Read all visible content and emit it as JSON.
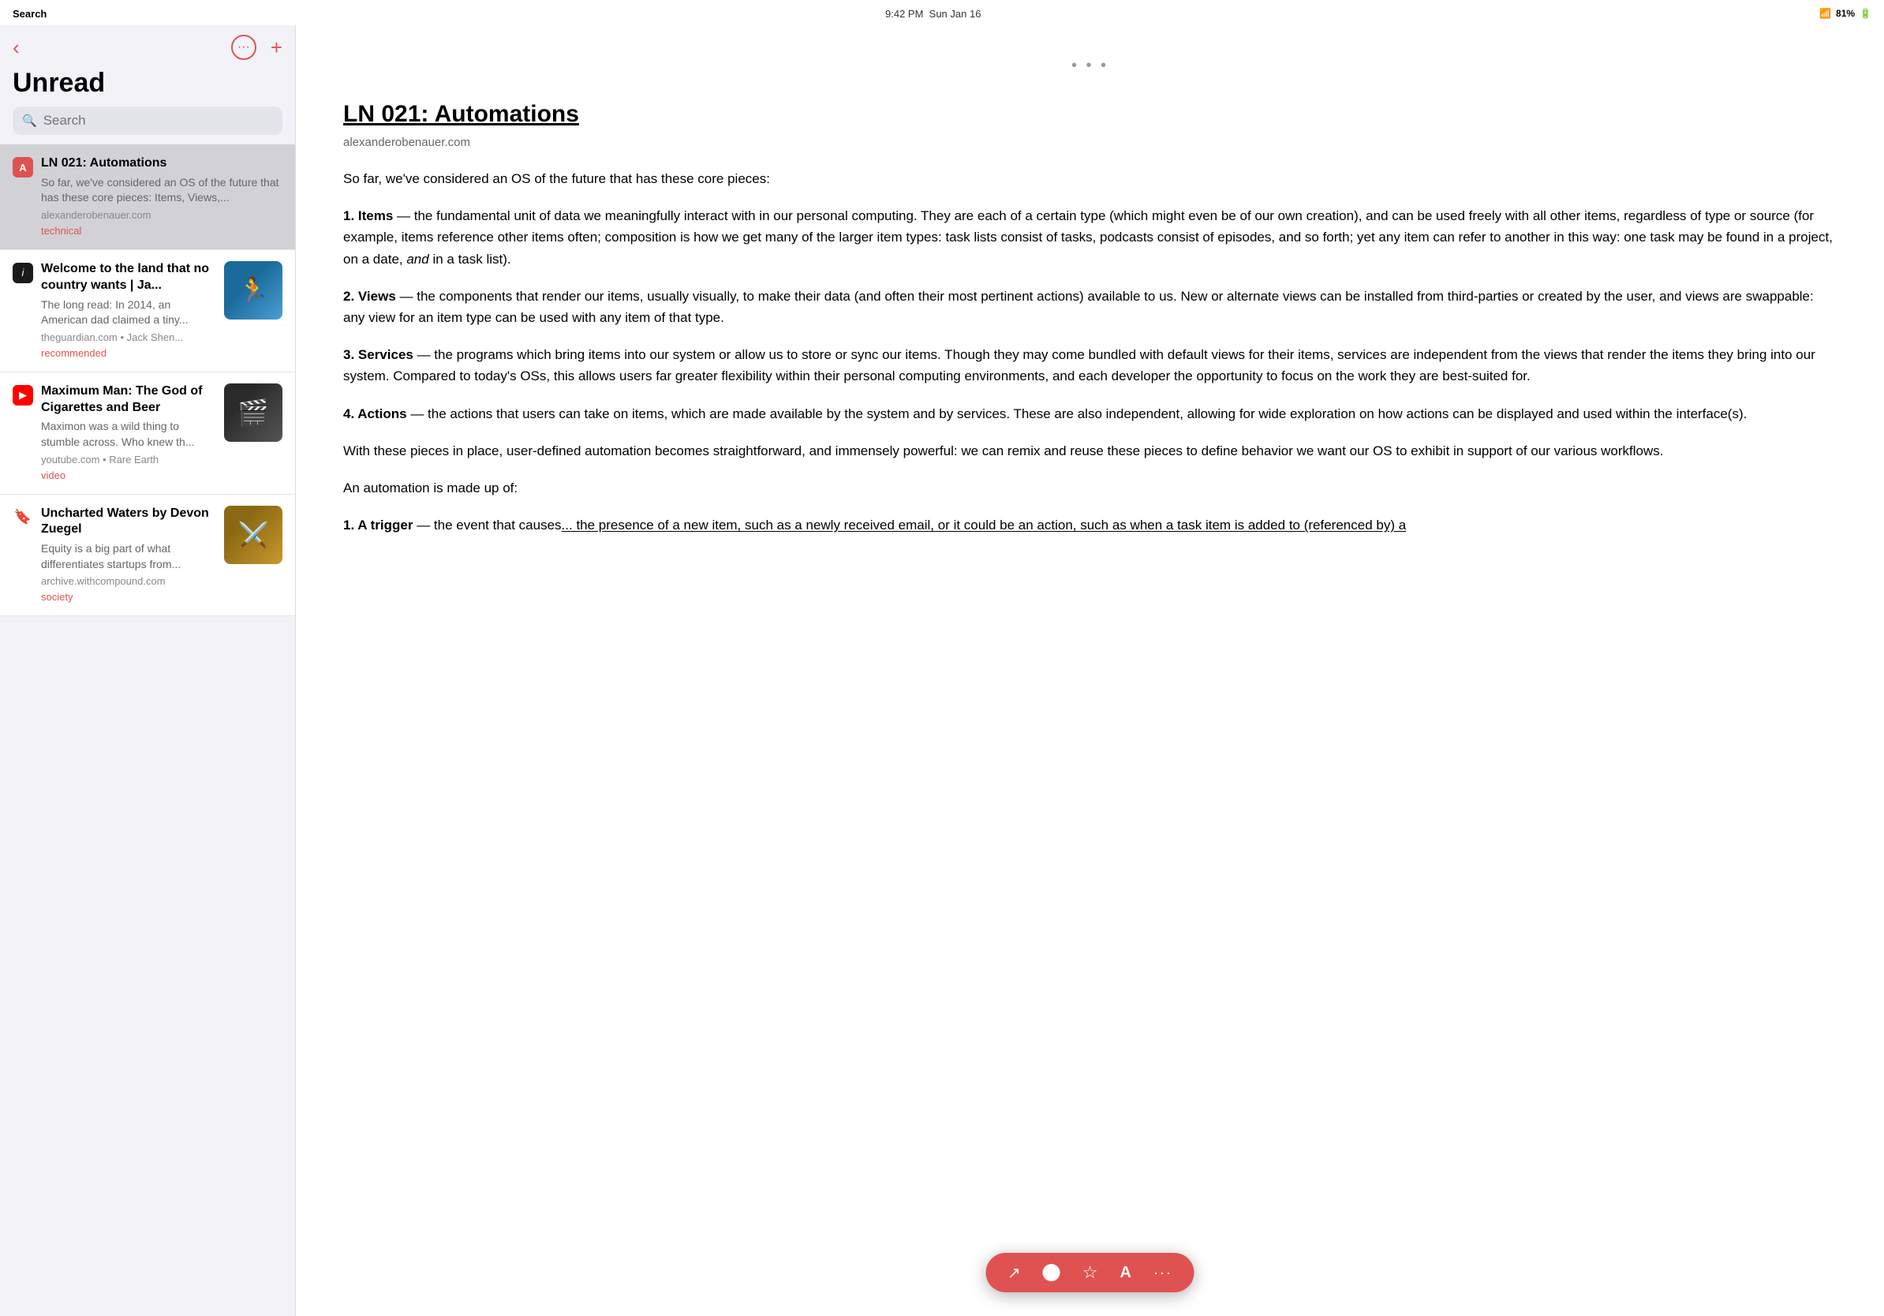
{
  "statusBar": {
    "carrier": "Search",
    "time": "9:42 PM",
    "date": "Sun Jan 16",
    "wifi": "WiFi",
    "battery": "81%"
  },
  "sidebar": {
    "title": "Unread",
    "search_placeholder": "Search",
    "back_label": "‹",
    "more_label": "···",
    "add_label": "+",
    "articles": [
      {
        "id": "ln021",
        "icon": "A",
        "icon_bg": "#e05252",
        "icon_color": "#fff",
        "title": "LN 021: Automations",
        "preview": "So far, we've considered an OS of the future that has these core pieces: Items, Views,...",
        "source": "alexanderobenauer.com",
        "tag": "technical",
        "tag_class": "tag-technical",
        "active": true,
        "has_thumbnail": false
      },
      {
        "id": "guardian",
        "icon": "i",
        "icon_bg": "#1a1a1a",
        "icon_color": "#fff",
        "title": "Welcome to the land that no country wants | Ja...",
        "preview": "The long read: In 2014, an American dad claimed a tiny...",
        "source": "theguardian.com • Jack Shen...",
        "tag": "recommended",
        "tag_class": "tag-recommended",
        "active": false,
        "has_thumbnail": true,
        "thumb_class": "thumb-guardian"
      },
      {
        "id": "youtube",
        "icon": "▶",
        "icon_bg": "#ff0000",
        "icon_color": "#fff",
        "title": "Maximum Man: The God of Cigarettes and Beer",
        "preview": "Maximon was a wild thing to stumble across. Who knew th...",
        "source": "youtube.com • Rare Earth",
        "tag": "video",
        "tag_class": "tag-video",
        "active": false,
        "has_thumbnail": true,
        "thumb_class": "thumb-youtube"
      },
      {
        "id": "archive",
        "icon": "🔖",
        "icon_bg": "transparent",
        "icon_color": "#000",
        "title": "Uncharted Waters by Devon Zuegel",
        "preview": "Equity is a big part of what differentiates startups from...",
        "source": "archive.withcompound.com",
        "tag": "society",
        "tag_class": "tag-society",
        "active": false,
        "has_thumbnail": true,
        "thumb_class": "thumb-archive"
      }
    ]
  },
  "detail": {
    "dots": "• • •",
    "title": "LN 021: Automations",
    "source": "alexanderobenauer.com",
    "paragraphs": [
      {
        "type": "plain",
        "text": "So far, we've considered an OS of the future that has these core pieces:"
      },
      {
        "type": "numbered",
        "number": "1",
        "term": "Items",
        "text": " — the fundamental unit of data we meaningfully interact with in our personal computing. They are each of a certain type (which might even be of our own creation), and can be used freely with all other items, regardless of type or source (for example, items reference other items often; composition is how we get many of the larger item types: task lists consist of tasks, podcasts consist of episodes, and so forth; yet any item can refer to another in this way: one task may be found in a project, on a date, and in a task list)."
      },
      {
        "type": "numbered",
        "number": "2",
        "term": "Views",
        "text": " — the components that render our items, usually visually, to make their data (and often their most pertinent actions) available to us. New or alternate views can be installed from third-parties or created by the user, and views are swappable: any view for an item type can be used with any item of that type."
      },
      {
        "type": "numbered",
        "number": "3",
        "term": "Services",
        "text": " — the programs which bring items into our system or allow us to store or sync our items. Though they may come bundled with default views for their items, services are independent from the views that render the items they bring into our system. Compared to today's OSs, this allows users far greater flexibility within their personal computing environments, and each developer the opportunity to focus on the work they are best-suited for."
      },
      {
        "type": "numbered",
        "number": "4",
        "term": "Actions",
        "text": " — the actions that users can take on items, which are made available by the system and by services. These are also independent, allowing for wide exploration on how actions can be displayed and used within the interface(s)."
      },
      {
        "type": "plain",
        "text": "With these pieces in place, user-defined automation becomes straightforward, and immensely powerful: we can remix and reuse these pieces to define behavior we want our OS to exhibit in support of our various workflows."
      },
      {
        "type": "plain",
        "text": "An automation is made up of:"
      },
      {
        "type": "numbered",
        "number": "1",
        "term": "A trigger",
        "text": " — the event that causes... the presence of a new item, such as a newly received email, or it could be an action, such as when a task item is added to (referenced by) a"
      }
    ]
  },
  "floatingToolbar": {
    "buttons": [
      {
        "icon": "↗",
        "name": "share-button"
      },
      {
        "icon": "●",
        "name": "circle-button"
      },
      {
        "icon": "☆",
        "name": "star-button"
      },
      {
        "icon": "A",
        "name": "font-button"
      },
      {
        "icon": "···",
        "name": "more-button"
      }
    ]
  }
}
